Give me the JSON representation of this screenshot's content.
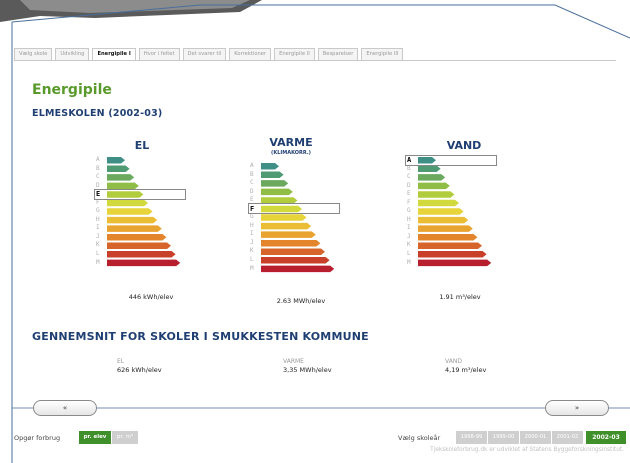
{
  "tabs": [
    {
      "label": "Vælg skole",
      "active": false
    },
    {
      "label": "Udvikling",
      "active": false
    },
    {
      "label": "Energipile I",
      "active": true
    },
    {
      "label": "Hvor i feltet",
      "active": false
    },
    {
      "label": "Det svarer til",
      "active": false
    },
    {
      "label": "Korrektioner",
      "active": false
    },
    {
      "label": "Energipile II",
      "active": false
    },
    {
      "label": "Besparelser",
      "active": false
    },
    {
      "label": "Energipile III",
      "active": false
    }
  ],
  "page_title": "Energipile",
  "school": "ELMESKOLEN (2002-03)",
  "grade_letters": [
    "A",
    "B",
    "C",
    "D",
    "E",
    "F",
    "G",
    "H",
    "I",
    "J",
    "K",
    "L",
    "M"
  ],
  "arrow_colors": [
    "#3f8f86",
    "#4d9a73",
    "#6aa95e",
    "#8fbd45",
    "#b1cc3c",
    "#d2d93c",
    "#e7d43a",
    "#ebbd34",
    "#e9a330",
    "#e2852d",
    "#d6642b",
    "#c8402a",
    "#b71f2e"
  ],
  "columns": [
    {
      "title": "EL",
      "subtitle": "",
      "grade": "E",
      "value": "446 kWh/elev"
    },
    {
      "title": "VARME",
      "subtitle": "(KLIMAKORR.)",
      "grade": "F",
      "value": "2.63 MWh/elev"
    },
    {
      "title": "VAND",
      "subtitle": "",
      "grade": "A",
      "value": "1.91 m³/elev"
    }
  ],
  "average": {
    "title": "GENNEMSNIT FOR SKOLER I SMUKKESTEN KOMMUNE",
    "items": [
      {
        "label": "EL",
        "value": "626 kWh/elev"
      },
      {
        "label": "VARME",
        "value": "3,35 MWh/elev"
      },
      {
        "label": "VAND",
        "value": "4,19 m³/elev"
      }
    ]
  },
  "nav": {
    "prev": "«",
    "next": "»"
  },
  "bottom": {
    "opgoer_label": "Opgør forbrug",
    "per_elev": "pr. elev",
    "per_m2": "pr. m²",
    "year_label": "Vælg skoleår",
    "years": [
      "1998-99",
      "1999-00",
      "2000-01",
      "2001-02",
      "2002-03"
    ],
    "active_year": "2002-03",
    "footer": "Tjekskoleforbrug.dk er udviklet af Statens Byggeforskningsinstitut."
  }
}
